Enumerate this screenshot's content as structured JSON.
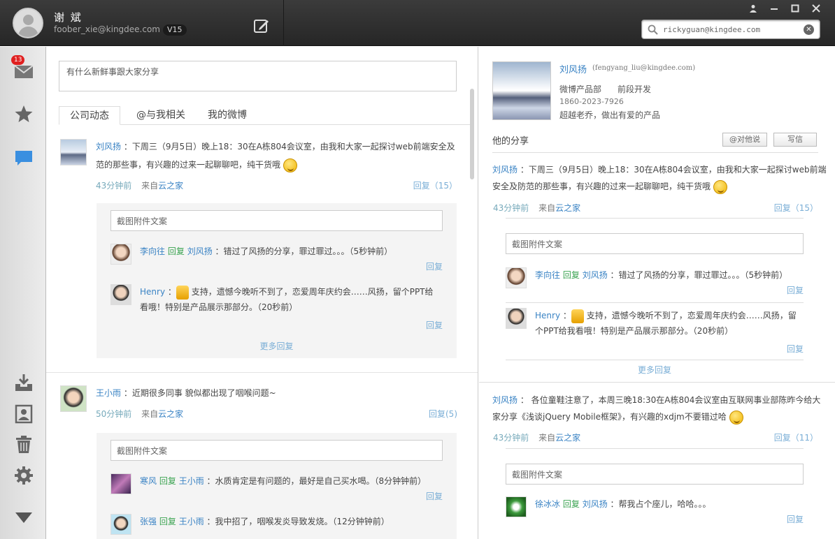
{
  "user": {
    "name": "谢 斌",
    "email": "foober_xie@kingdee.com",
    "level": "V15"
  },
  "search": {
    "value": "rickyguan@kingdee.com"
  },
  "sidebar": {
    "inbox_badge": "13"
  },
  "composer": {
    "placeholder": "有什么新鲜事跟大家分享"
  },
  "tabs": [
    "公司动态",
    "@与我相关",
    "我的微博"
  ],
  "feed": [
    {
      "author": "刘风扬",
      "text": "：下周三（9月5日）晚上18：30在A栋804会议室，由我和大家一起探讨web前端安全及范的那些事，有兴趣的过来一起聊聊吧，纯干货哦",
      "time": "43分钟前",
      "from_label": "来自",
      "from": "云之家",
      "reply_count": "回复（15）",
      "input_placeholder": "截图附件文案",
      "replies": [
        {
          "author": "李向往",
          "verb": "回复",
          "target": "刘风扬",
          "text": "：错过了风扬的分享，罪过罪过。。。（5秒钟前）",
          "reply": "回复"
        },
        {
          "author": "Henry",
          "verb": "",
          "target": "",
          "text": "支持，遗憾今晚听不到了，恋爱周年庆约会……风扬，留个PPT给看哦！特别是产品展示那部分。（20秒前）",
          "reply": "回复"
        }
      ],
      "more": "更多回复"
    },
    {
      "author": "王小雨",
      "text": "：近期很多同事 貌似都出现了咽喉问题~",
      "time": "50分钟前",
      "from_label": "来自",
      "from": "云之家",
      "reply_count": "回复(5)",
      "input_placeholder": "截图附件文案",
      "replies": [
        {
          "author": "寒风",
          "verb": "回复",
          "target": "王小雨",
          "text": "：水质肯定是有问题的，最好是自己买水喝。（8分钟钟前）",
          "reply": "回复"
        },
        {
          "author": "张强",
          "verb": "回复",
          "target": "王小雨",
          "text": "：我中招了，咽喉发炎导致发烧。（12分钟钟前）",
          "reply": "回复"
        }
      ]
    }
  ],
  "profile": {
    "name": "刘风扬",
    "email": "(fengyang_liu@kingdee.com)",
    "dept": "微博产品部",
    "role": "前段开发",
    "phone": "1860-2023-7926",
    "motto": "超越老乔，做出有爱的产品",
    "section": "他的分享",
    "btn_talk": "@对他说",
    "btn_mail": "写信"
  },
  "right_posts": [
    {
      "author": "刘风扬",
      "text": "：下周三（9月5日）晚上18：30在A栋804会议室，由我和大家一起探讨web前端安全及防范的那些事，有兴趣的过来一起聊聊吧，纯干货哦",
      "time": "43分钟前",
      "from_label": "来自",
      "from": "云之家",
      "reply_count": "回复（15）",
      "input_placeholder": "截图附件文案",
      "replies": [
        {
          "author": "李向往",
          "verb": "回复",
          "target": "刘风扬",
          "text": "：错过了风扬的分享，罪过罪过。。。（5秒钟前）",
          "reply": "回复"
        },
        {
          "author": "Henry",
          "verb": "",
          "target": "",
          "text": "支持，遗憾今晚听不到了，恋爱周年庆约会……风扬，留个PPT给我看哦！特别是产品展示那部分。（20秒前）",
          "reply": "回复"
        }
      ],
      "more": "更多回复"
    },
    {
      "author": "刘风扬",
      "text": "：  各位童鞋注意了，本周三晚18:30在A栋804会议室由互联网事业部陈昨今给大家分享《浅谈jQuery Mobile框架》，有兴趣的xdjm不要错过哈",
      "time": "43分钟前",
      "from_label": "来自",
      "from": "云之家",
      "reply_count": "回复（11）",
      "input_placeholder": "截图附件文案",
      "replies": [
        {
          "author": "徐冰冰",
          "verb": "回复",
          "target": "刘风扬",
          "text": "：帮我占个座儿，哈哈。。。",
          "reply": "回复"
        }
      ]
    }
  ]
}
